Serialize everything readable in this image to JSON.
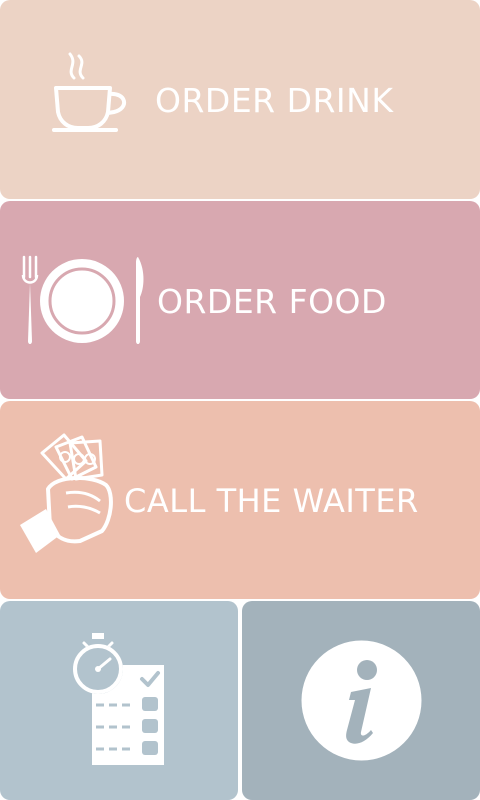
{
  "colors": {
    "drink_tile": "#ecd3c5",
    "food_tile": "#d8a8b0",
    "waiter_tile": "#edbfae",
    "orders_tile": "#b2c3cd",
    "info_tile": "#a3b2bb",
    "icon": "#ffffff"
  },
  "tiles": {
    "drink": {
      "label": "ORDER DRINK",
      "icon": "coffee-cup-icon"
    },
    "food": {
      "label": "ORDER FOOD",
      "icon": "plate-cutlery-icon"
    },
    "waiter": {
      "label": "CALL THE WAITER",
      "icon": "hand-money-icon"
    },
    "orders": {
      "icon": "order-checklist-timer-icon"
    },
    "info": {
      "icon": "info-icon"
    }
  }
}
